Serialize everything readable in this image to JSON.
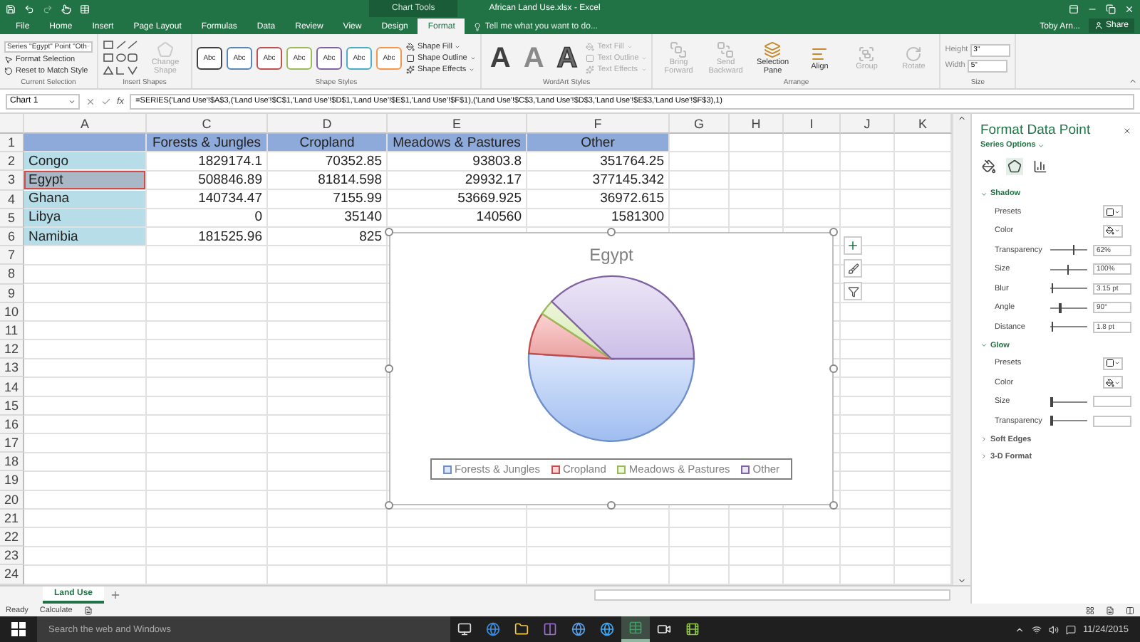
{
  "title_bar": {
    "context_label": "Chart Tools",
    "title": "African Land Use.xlsx - Excel"
  },
  "ribbon_tabs": [
    {
      "label": "File",
      "selected": false
    },
    {
      "label": "Home",
      "selected": false
    },
    {
      "label": "Insert",
      "selected": false
    },
    {
      "label": "Page Layout",
      "selected": false
    },
    {
      "label": "Formulas",
      "selected": false
    },
    {
      "label": "Data",
      "selected": false
    },
    {
      "label": "Review",
      "selected": false
    },
    {
      "label": "View",
      "selected": false
    },
    {
      "label": "Design",
      "selected": false
    },
    {
      "label": "Format",
      "selected": true
    }
  ],
  "tell_me": {
    "placeholder": "Tell me what you want to do..."
  },
  "account": {
    "user": "Toby Arn...",
    "share": "Share"
  },
  "ribbon": {
    "groups": [
      {
        "kind": "selection",
        "label": "Current Selection",
        "dropdown": "Series \"Egypt\" Point \"Oth",
        "buttons": [
          {
            "kind": "format",
            "label": "Format Selection",
            "disabled": false
          },
          {
            "kind": "reset",
            "label": "Reset to Match Style",
            "disabled": false
          }
        ]
      },
      {
        "kind": "shapes",
        "label": "Insert Shapes",
        "buttons": [
          {
            "kind": "change",
            "label": "Change Shape",
            "disabled": true
          }
        ]
      },
      {
        "kind": "styles",
        "label": "Shape Styles",
        "swatches": [
          {
            "text": "Abc",
            "color": "#404040"
          },
          {
            "text": "Abc",
            "color": "#5b87b8"
          },
          {
            "text": "Abc",
            "color": "#c0504d"
          },
          {
            "text": "Abc",
            "color": "#9bbb59"
          },
          {
            "text": "Abc",
            "color": "#8064a2"
          },
          {
            "text": "Abc",
            "color": "#4bacc6"
          },
          {
            "text": "Abc",
            "color": "#f79646"
          }
        ],
        "buttons": [
          {
            "kind": "fill",
            "label": "Shape Fill",
            "disabled": false
          },
          {
            "kind": "outline",
            "label": "Shape Outline",
            "disabled": false
          },
          {
            "kind": "effects",
            "label": "Shape Effects",
            "disabled": false
          }
        ]
      },
      {
        "kind": "wordart",
        "label": "WordArt Styles",
        "letters": [
          {
            "kind": "solid",
            "text": "A"
          },
          {
            "kind": "light",
            "text": "A"
          },
          {
            "kind": "outline",
            "text": "A"
          }
        ],
        "buttons": [
          {
            "kind": "fill",
            "label": "Text Fill",
            "disabled": true
          },
          {
            "kind": "outline",
            "label": "Text Outline",
            "disabled": true
          },
          {
            "kind": "effects",
            "label": "Text Effects",
            "disabled": true
          }
        ]
      },
      {
        "kind": "arrange",
        "label": "Arrange",
        "buttons": [
          {
            "kind": "forward",
            "label": "Bring Forward",
            "disabled": true
          },
          {
            "kind": "backward",
            "label": "Send Backward",
            "disabled": true
          },
          {
            "kind": "pane",
            "label": "Selection Pane",
            "disabled": false
          },
          {
            "kind": "align",
            "label": "Align",
            "disabled": false
          },
          {
            "kind": "group",
            "label": "Group",
            "disabled": true
          },
          {
            "kind": "rotate",
            "label": "Rotate",
            "disabled": true
          }
        ]
      },
      {
        "kind": "size",
        "label": "Size",
        "fields": [
          {
            "label": "Height",
            "value": "3\""
          },
          {
            "label": "Width",
            "value": "5\""
          }
        ]
      }
    ]
  },
  "formula_bar": {
    "name_box": "Chart 1",
    "function_label": "fx",
    "formula": "=SERIES('Land Use'!$A$3,('Land Use'!$C$1,'Land Use'!$D$1,'Land Use'!$E$1,'Land Use'!$F$1),('Land Use'!$C$3,'Land Use'!$D$3,'Land Use'!$E$3,'Land Use'!$F$3),1)"
  },
  "sheet": {
    "columns": [
      "A",
      "C",
      "D",
      "E",
      "F",
      "G",
      "H",
      "I",
      "J",
      "K"
    ],
    "rows": [
      {
        "number": "1",
        "kind": "header",
        "values": [
          "Forests & Jungles",
          "Cropland",
          "Meadows & Pastures",
          "Other"
        ]
      },
      {
        "number": "2",
        "kind": "data",
        "name": "Congo",
        "referenced": false,
        "values": [
          "1829174.1",
          "70352.85",
          "93803.8",
          "351764.25"
        ]
      },
      {
        "number": "3",
        "kind": "data",
        "name": "Egypt",
        "referenced": true,
        "values": [
          "508846.89",
          "81814.598",
          "29932.17",
          "377145.342"
        ]
      },
      {
        "number": "4",
        "kind": "data",
        "name": "Ghana",
        "referenced": false,
        "values": [
          "140734.47",
          "7155.99",
          "53669.925",
          "36972.615"
        ]
      },
      {
        "number": "5",
        "kind": "data",
        "name": "Libya",
        "referenced": false,
        "values": [
          "0",
          "35140",
          "140560",
          "1581300"
        ]
      },
      {
        "number": "6",
        "kind": "data",
        "name": "Namibia",
        "referenced": false,
        "values": [
          "181525.96",
          "825"
        ]
      },
      {
        "number": "7",
        "kind": "empty"
      },
      {
        "number": "8",
        "kind": "empty"
      },
      {
        "number": "9",
        "kind": "empty"
      },
      {
        "number": "10",
        "kind": "empty"
      },
      {
        "number": "11",
        "kind": "empty"
      },
      {
        "number": "12",
        "kind": "empty"
      },
      {
        "number": "13",
        "kind": "empty"
      },
      {
        "number": "14",
        "kind": "empty"
      },
      {
        "number": "15",
        "kind": "empty"
      },
      {
        "number": "16",
        "kind": "empty"
      },
      {
        "number": "17",
        "kind": "empty"
      },
      {
        "number": "18",
        "kind": "empty"
      },
      {
        "number": "19",
        "kind": "empty"
      },
      {
        "number": "20",
        "kind": "empty"
      },
      {
        "number": "21",
        "kind": "empty"
      },
      {
        "number": "22",
        "kind": "empty"
      },
      {
        "number": "23",
        "kind": "empty"
      },
      {
        "number": "24",
        "kind": "empty"
      }
    ],
    "chart": {
      "chart_data": {
        "type": "pie",
        "title": "Egypt",
        "categories": [
          "Forests & Jungles",
          "Cropland",
          "Meadows & Pastures",
          "Other"
        ],
        "series": [
          {
            "values": [
              51.0,
              8.2,
              3.0,
              37.8
            ]
          }
        ]
      }
    }
  },
  "sheet_tabs": [
    {
      "label": "Land Use",
      "selected": true
    }
  ],
  "status_bar": {
    "items": [
      "Ready",
      "Calculate"
    ]
  },
  "format_pane": {
    "title": "Format Data Point",
    "options": "Series Options",
    "icon_tabs": [
      {
        "kind": "fill",
        "selected": false
      },
      {
        "kind": "effects",
        "selected": true
      },
      {
        "kind": "series",
        "selected": false
      }
    ],
    "sections": [
      {
        "title": "Shadow",
        "expanded": true,
        "rows": [
          {
            "kind": "presets",
            "label": "Presets"
          },
          {
            "kind": "color",
            "label": "Color"
          },
          {
            "kind": "slider",
            "label": "Transparency",
            "level": 0.62,
            "value": "62%"
          },
          {
            "kind": "slider",
            "label": "Size",
            "level": 0.45,
            "value": "100%"
          },
          {
            "kind": "slider",
            "label": "Blur",
            "level": 0.03,
            "value": "3.15 pt"
          },
          {
            "kind": "slider",
            "label": "Angle",
            "level": 0.25,
            "value": "90°"
          },
          {
            "kind": "slider",
            "label": "Distance",
            "level": 0.02,
            "value": "1.8 pt"
          }
        ]
      },
      {
        "title": "Glow",
        "expanded": true,
        "rows": [
          {
            "kind": "presets",
            "label": "Presets"
          },
          {
            "kind": "color",
            "label": "Color"
          },
          {
            "kind": "slider",
            "label": "Size",
            "level": 0
          },
          {
            "kind": "slider",
            "label": "Transparency",
            "level": 0
          }
        ]
      },
      {
        "title": "Soft Edges",
        "expanded": false
      },
      {
        "title": "3-D Format",
        "expanded": false
      }
    ]
  },
  "taskbar": {
    "search_placeholder": "Search the web and Windows",
    "apps": [
      {
        "kind": "taskview",
        "selected": false
      },
      {
        "kind": "edge",
        "selected": false
      },
      {
        "kind": "folder",
        "selected": false
      },
      {
        "kind": "studio",
        "selected": false
      },
      {
        "kind": "globe",
        "selected": false
      },
      {
        "kind": "ie",
        "selected": false
      },
      {
        "kind": "excel",
        "selected": true
      },
      {
        "kind": "recorder",
        "selected": false
      },
      {
        "kind": "editor",
        "selected": false
      }
    ],
    "date": "11/24/2015"
  }
}
